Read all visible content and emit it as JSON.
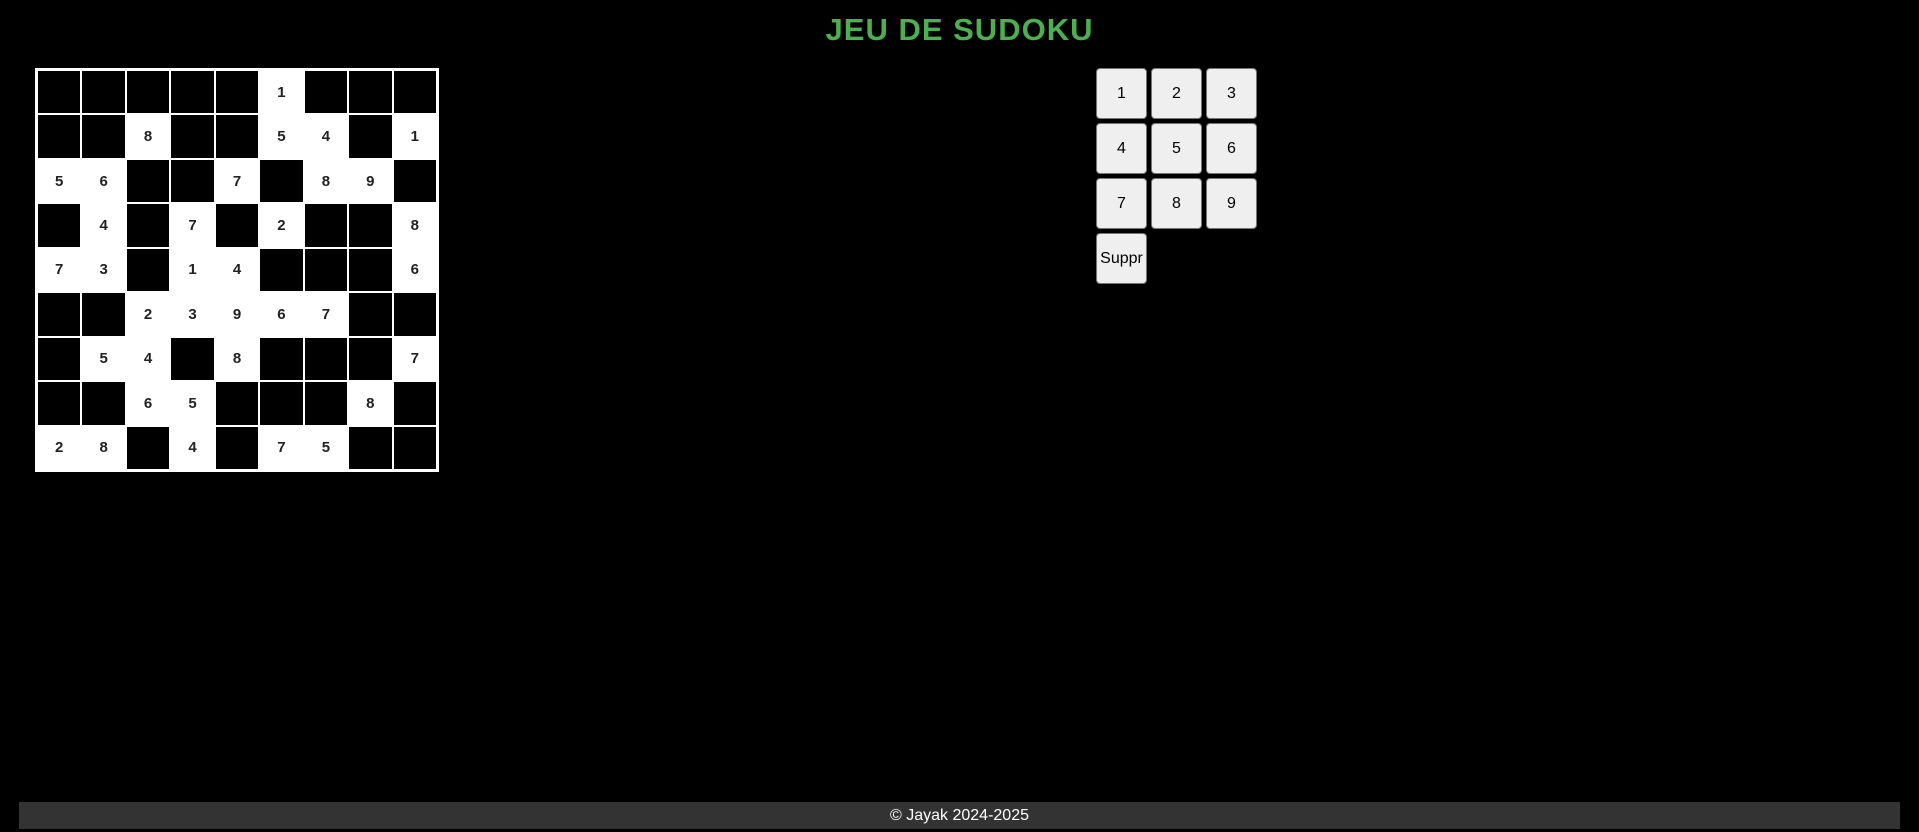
{
  "title": "JEU DE SUDOKU",
  "colors": {
    "title": "#4caf50",
    "background": "#000000",
    "empty_cell": "#000000",
    "filled_cell": "#ffffff",
    "footer_bg": "#333333",
    "key_bg": "#efefef"
  },
  "grid": [
    [
      "",
      "",
      "",
      "",
      "",
      "1",
      "",
      "",
      ""
    ],
    [
      "",
      "",
      "8",
      "",
      "",
      "5",
      "4",
      "",
      "1"
    ],
    [
      "5",
      "6",
      "",
      "",
      "7",
      "",
      "8",
      "9",
      ""
    ],
    [
      "",
      "4",
      "",
      "7",
      "",
      "2",
      "",
      "",
      "8"
    ],
    [
      "7",
      "3",
      "",
      "1",
      "4",
      "",
      "",
      "",
      "6"
    ],
    [
      "",
      "",
      "2",
      "3",
      "9",
      "6",
      "7",
      "",
      ""
    ],
    [
      "",
      "5",
      "4",
      "",
      "8",
      "",
      "",
      "",
      "7"
    ],
    [
      "",
      "",
      "6",
      "5",
      "",
      "",
      "",
      "8",
      ""
    ],
    [
      "2",
      "8",
      "",
      "4",
      "",
      "7",
      "5",
      "",
      ""
    ]
  ],
  "keypad": {
    "keys": [
      "1",
      "2",
      "3",
      "4",
      "5",
      "6",
      "7",
      "8",
      "9"
    ],
    "delete_label": "Suppr"
  },
  "footer": {
    "text": "© Jayak 2024-2025"
  }
}
